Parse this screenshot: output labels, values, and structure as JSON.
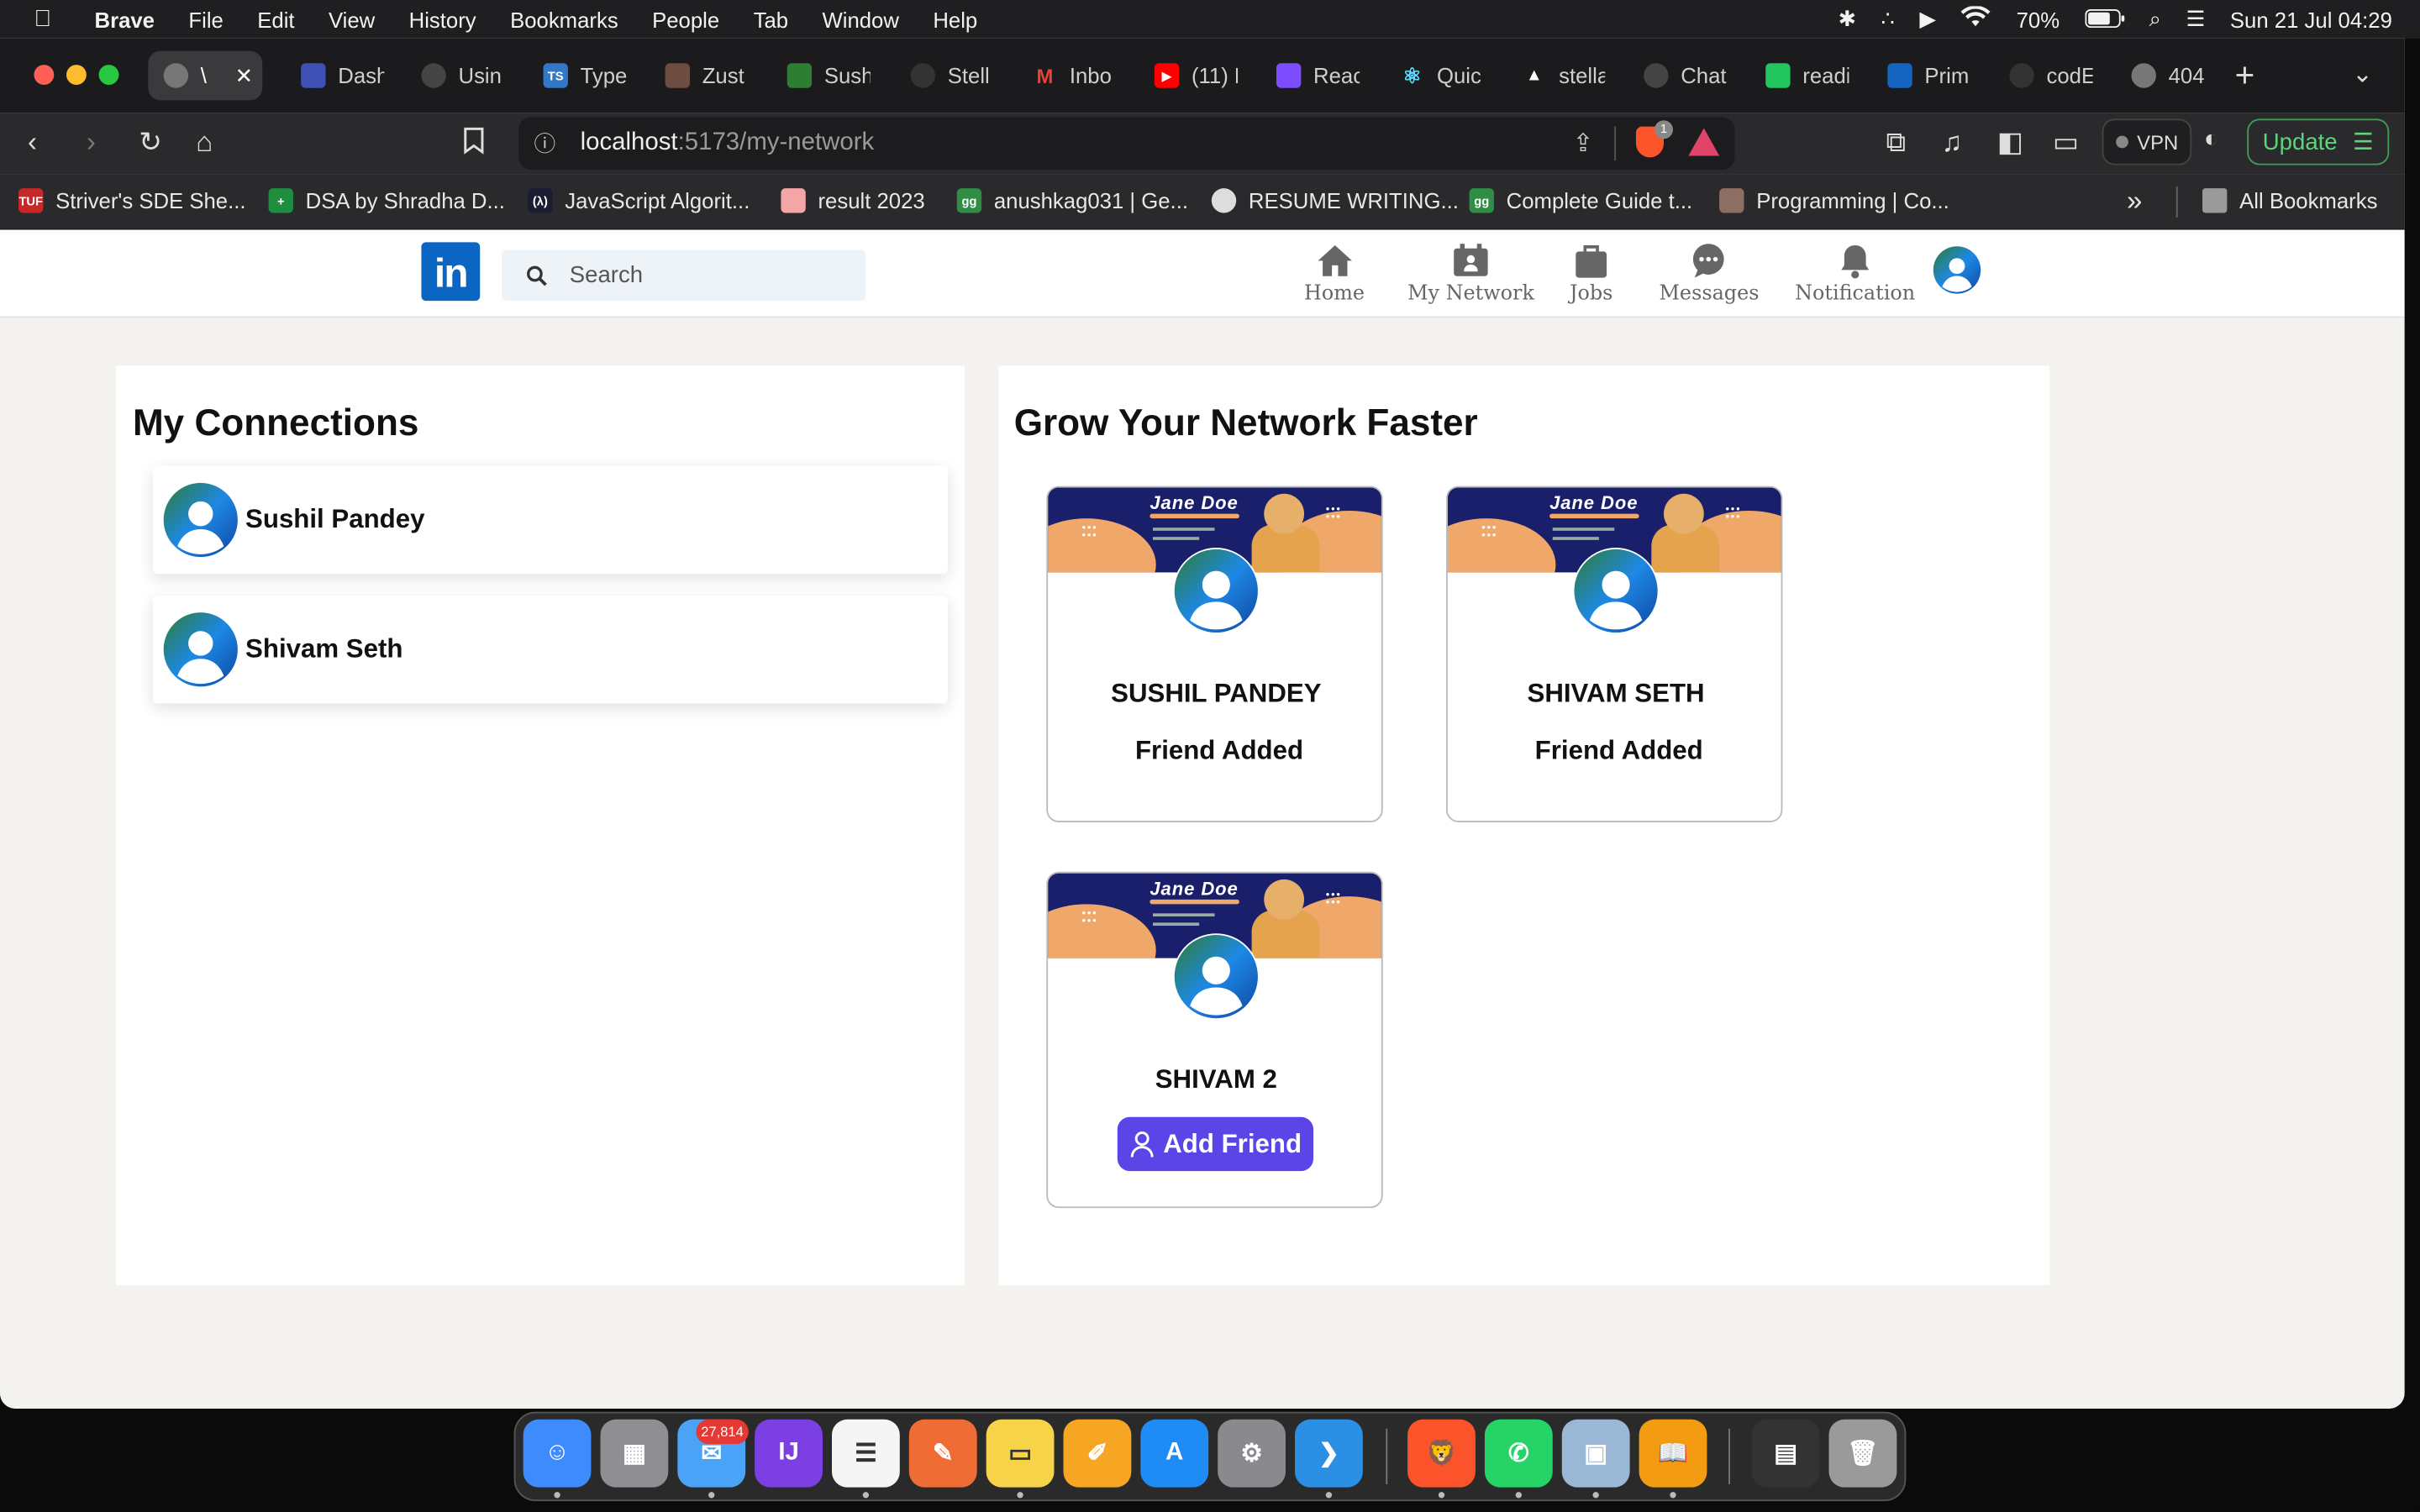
{
  "menubar": {
    "app": "Brave",
    "items": [
      "File",
      "Edit",
      "View",
      "History",
      "Bookmarks",
      "People",
      "Tab",
      "Window",
      "Help"
    ],
    "battery": "70%",
    "datetime": "Sun 21 Jul  04:29"
  },
  "tabs": [
    {
      "label": "\\",
      "icon": "globe-icon",
      "active": true
    },
    {
      "label": "Dash",
      "icon": "dashboard-icon"
    },
    {
      "label": "Usin",
      "icon": "chatgpt-icon"
    },
    {
      "label": "Type",
      "icon": "typescript-icon"
    },
    {
      "label": "Zust",
      "icon": "zustand-icon"
    },
    {
      "label": "Sush",
      "icon": "leaf-icon"
    },
    {
      "label": "Stell",
      "icon": "github-icon"
    },
    {
      "label": "Inbo",
      "icon": "gmail-icon"
    },
    {
      "label": "(11) F",
      "icon": "youtube-icon"
    },
    {
      "label": "Reac",
      "icon": "docs-icon"
    },
    {
      "label": "Quic",
      "icon": "react-icon"
    },
    {
      "label": "stella",
      "icon": "vercel-icon"
    },
    {
      "label": "Chat",
      "icon": "chatgpt-icon"
    },
    {
      "label": "readi",
      "icon": "sheet-icon"
    },
    {
      "label": "Prim",
      "icon": "play-icon"
    },
    {
      "label": "codE",
      "icon": "github-icon"
    },
    {
      "label": "404",
      "icon": "globe-icon"
    }
  ],
  "toolbar": {
    "url_host": "localhost",
    "url_path": ":5173/my-network",
    "shield_count": "1",
    "vpn": "VPN",
    "update": "Update"
  },
  "bookmarks": [
    {
      "label": "Striver's SDE She...",
      "color": "#c62828",
      "abbr": "TUF"
    },
    {
      "label": "DSA by Shradha D...",
      "color": "#1e8e3e",
      "abbr": "+"
    },
    {
      "label": "JavaScript Algorit...",
      "color": "#1b1b32",
      "abbr": "(λ)"
    },
    {
      "label": "result 2023",
      "color": "#f4a6a6",
      "abbr": ""
    },
    {
      "label": "anushkag031 | Ge...",
      "color": "#2f8d46",
      "abbr": "gg"
    },
    {
      "label": "RESUME WRITING...",
      "color": "#555",
      "abbr": ""
    },
    {
      "label": "Complete Guide t...",
      "color": "#2f8d46",
      "abbr": "gg"
    },
    {
      "label": "Programming | Co...",
      "color": "#8d6e63",
      "abbr": ""
    }
  ],
  "bookmarks_folder": "All Bookmarks",
  "navbar": {
    "logo": "in",
    "search_placeholder": "Search",
    "items": [
      {
        "label": "Home",
        "icon": "home-icon"
      },
      {
        "label": "My Network",
        "icon": "network-icon"
      },
      {
        "label": "Jobs",
        "icon": "briefcase-icon"
      },
      {
        "label": "Messages",
        "icon": "message-icon"
      },
      {
        "label": "Notification",
        "icon": "bell-icon"
      }
    ]
  },
  "connections": {
    "title": "My Connections",
    "people": [
      {
        "name": "Sushil Pandey"
      },
      {
        "name": "Shivam Seth"
      }
    ]
  },
  "grow": {
    "title": "Grow Your Network Faster",
    "banner_name": "Jane Doe",
    "cards": [
      {
        "name": "SUSHIL PANDEY",
        "status": "Friend Added"
      },
      {
        "name": "SHIVAM SETH",
        "status": "Friend Added"
      },
      {
        "name": "SHIVAM 2",
        "button": "Add Friend"
      }
    ]
  },
  "dock": {
    "mail_badge": "27,814",
    "apps": [
      {
        "name": "finder",
        "color": "#3d8bfd"
      },
      {
        "name": "launchpad",
        "color": "#8e8e93"
      },
      {
        "name": "mail",
        "color": "#4aa3f7"
      },
      {
        "name": "intellij",
        "color": "#7b3fe4"
      },
      {
        "name": "reminders",
        "color": "#f5f5f5"
      },
      {
        "name": "postman",
        "color": "#ef6c35"
      },
      {
        "name": "notes",
        "color": "#f7d34a"
      },
      {
        "name": "pages",
        "color": "#f6a623"
      },
      {
        "name": "app-store",
        "color": "#1f8cf5"
      },
      {
        "name": "system-settings",
        "color": "#8a8a8e"
      },
      {
        "name": "vscode",
        "color": "#2b8fe4"
      },
      {
        "name": "brave",
        "color": "#fb542b"
      },
      {
        "name": "whatsapp",
        "color": "#25d366"
      },
      {
        "name": "preview",
        "color": "#9ab7d6"
      },
      {
        "name": "books",
        "color": "#f39c12"
      },
      {
        "name": "activity-monitor",
        "color": "#333"
      },
      {
        "name": "trash",
        "color": "#9a9a9a"
      }
    ]
  }
}
